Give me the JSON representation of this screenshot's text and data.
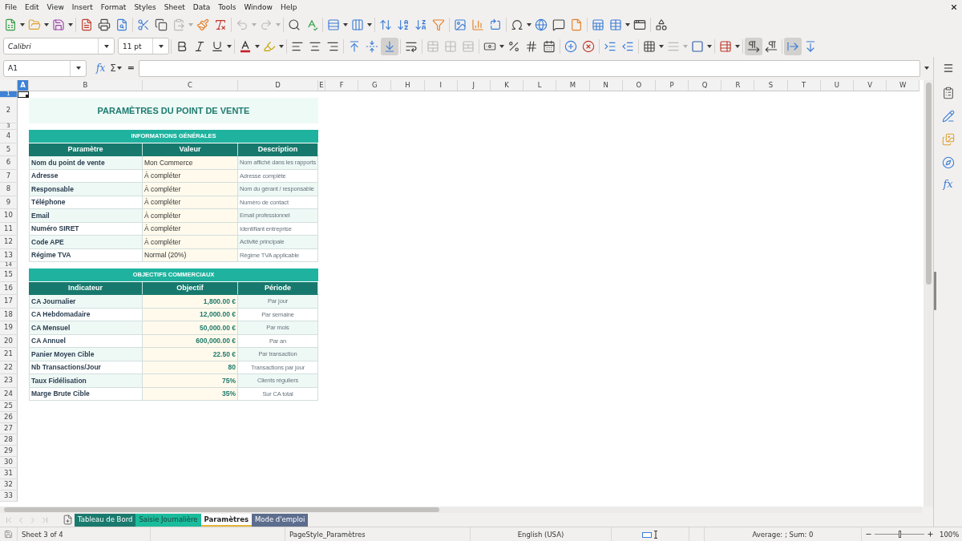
{
  "menu_bar": {
    "items": [
      "File",
      "Edit",
      "View",
      "Insert",
      "Format",
      "Styles",
      "Sheet",
      "Data",
      "Tools",
      "Window",
      "Help"
    ]
  },
  "standard_toolbar": [
    {
      "disabled": false
    },
    {
      "disabled": false
    },
    {
      "disabled": false
    },
    {
      "disabled": false
    },
    {
      "disabled": false
    },
    {
      "disabled": false
    },
    {
      "disabled": false
    },
    {
      "disabled": false
    },
    {
      "disabled": true
    },
    {
      "disabled": false
    },
    {
      "disabled": false
    },
    {
      "disabled": true
    },
    {
      "disabled": true
    },
    {
      "disabled": false
    },
    {
      "disabled": false
    },
    {
      "disabled": false
    },
    {
      "disabled": false
    },
    {
      "disabled": false
    },
    {
      "disabled": false
    },
    {
      "disabled": false
    },
    {
      "disabled": false
    },
    {
      "disabled": false
    },
    {
      "disabled": false
    },
    {
      "disabled": false
    },
    {
      "disabled": false
    },
    {
      "disabled": false
    },
    {
      "disabled": false
    },
    {
      "disabled": false
    },
    {
      "disabled": false
    },
    {
      "disabled": false
    },
    {
      "disabled": false
    },
    {
      "disabled": false
    }
  ],
  "formatting_toolbar": {
    "font_name": "Calibri",
    "font_size": "11 pt",
    "buttons": [
      {
        "pressed": false,
        "disabled": false
      },
      {
        "pressed": false,
        "disabled": false
      },
      {
        "pressed": false,
        "disabled": false
      },
      {
        "pressed": false,
        "disabled": false
      },
      {
        "pressed": false,
        "disabled": false
      },
      {
        "pressed": false,
        "disabled": false
      },
      {
        "pressed": false,
        "disabled": false
      },
      {
        "pressed": false,
        "disabled": false
      },
      {
        "pressed": false,
        "disabled": false
      },
      {
        "pressed": false,
        "disabled": false
      },
      {
        "pressed": true,
        "disabled": false
      },
      {
        "pressed": false,
        "disabled": false
      },
      {
        "pressed": false,
        "disabled": true
      },
      {
        "pressed": false,
        "disabled": true
      },
      {
        "pressed": false,
        "disabled": true
      },
      {
        "pressed": false,
        "disabled": false
      },
      {
        "pressed": false,
        "disabled": false
      },
      {
        "pressed": false,
        "disabled": false
      },
      {
        "pressed": false,
        "disabled": false
      },
      {
        "pressed": false,
        "disabled": false
      },
      {
        "pressed": false,
        "disabled": false
      },
      {
        "pressed": false,
        "disabled": false
      },
      {
        "pressed": false,
        "disabled": false
      },
      {
        "pressed": false,
        "disabled": false
      },
      {
        "pressed": false,
        "disabled": true
      },
      {
        "pressed": false,
        "disabled": false
      },
      {
        "pressed": false,
        "disabled": false
      },
      {
        "pressed": true,
        "disabled": false
      },
      {
        "pressed": false,
        "disabled": false
      },
      {
        "pressed": true,
        "disabled": false
      },
      {
        "pressed": false,
        "disabled": false
      }
    ]
  },
  "formula_bar": {
    "name_box": "A1",
    "function_wizard": "fx",
    "sum": "Σ",
    "formula": "="
  },
  "sidebar": {
    "functions": "fx"
  },
  "columns": [
    {
      "label": "A",
      "selected": true
    },
    {
      "label": "B",
      "selected": false
    },
    {
      "label": "C",
      "selected": false
    },
    {
      "label": "D",
      "selected": false
    },
    {
      "label": "E",
      "selected": false
    },
    {
      "label": "F",
      "selected": false
    },
    {
      "label": "G",
      "selected": false
    },
    {
      "label": "H",
      "selected": false
    },
    {
      "label": "I",
      "selected": false
    },
    {
      "label": "J",
      "selected": false
    },
    {
      "label": "K",
      "selected": false
    },
    {
      "label": "L",
      "selected": false
    },
    {
      "label": "M",
      "selected": false
    },
    {
      "label": "N",
      "selected": false
    },
    {
      "label": "O",
      "selected": false
    },
    {
      "label": "P",
      "selected": false
    },
    {
      "label": "Q",
      "selected": false
    },
    {
      "label": "R",
      "selected": false
    },
    {
      "label": "S",
      "selected": false
    },
    {
      "label": "T",
      "selected": false
    },
    {
      "label": "U",
      "selected": false
    },
    {
      "label": "V",
      "selected": false
    },
    {
      "label": "W",
      "selected": false
    }
  ],
  "rows": [
    {
      "number": "1",
      "kind": "spacer",
      "selected": true
    },
    {
      "number": "2",
      "kind": "title",
      "selected": false,
      "title": "PARAMÈTRES DU POINT DE VENTE"
    },
    {
      "number": "3",
      "kind": "spacer",
      "selected": false
    },
    {
      "number": "4",
      "kind": "section",
      "selected": false,
      "title": "INFORMATIONS GÉNÉRALES"
    },
    {
      "number": "5",
      "kind": "header",
      "selected": false,
      "cells": [
        "Paramètre",
        "Valeur",
        "Description"
      ]
    },
    {
      "number": "6",
      "kind": "parameter",
      "selected": false,
      "shaded": true,
      "cells": [
        "Nom du point de vente",
        "Mon Commerce",
        "Nom affiché dans les rapports"
      ]
    },
    {
      "number": "7",
      "kind": "parameter",
      "selected": false,
      "shaded": false,
      "cells": [
        "Adresse",
        "À compléter",
        "Adresse complète"
      ]
    },
    {
      "number": "8",
      "kind": "parameter",
      "selected": false,
      "shaded": true,
      "cells": [
        "Responsable",
        "À compléter",
        "Nom du gérant / responsable"
      ]
    },
    {
      "number": "9",
      "kind": "parameter",
      "selected": false,
      "shaded": false,
      "cells": [
        "Téléphone",
        "À compléter",
        "Numéro de contact"
      ]
    },
    {
      "number": "10",
      "kind": "parameter",
      "selected": false,
      "shaded": true,
      "cells": [
        "Email",
        "À compléter",
        "Email professionnel"
      ]
    },
    {
      "number": "11",
      "kind": "parameter",
      "selected": false,
      "shaded": false,
      "cells": [
        "Numéro SIRET",
        "À compléter",
        "Identifiant entreprise"
      ]
    },
    {
      "number": "12",
      "kind": "parameter",
      "selected": false,
      "shaded": true,
      "cells": [
        "Code APE",
        "À compléter",
        "Activité principale"
      ]
    },
    {
      "number": "13",
      "kind": "parameter",
      "selected": false,
      "shaded": false,
      "cells": [
        "Régime TVA",
        "Normal (20%)",
        "Régime TVA applicable"
      ]
    },
    {
      "number": "14",
      "kind": "spacer",
      "selected": false
    },
    {
      "number": "15",
      "kind": "section",
      "selected": false,
      "title": "OBJECTIFS COMMERCIAUX"
    },
    {
      "number": "16",
      "kind": "header",
      "selected": false,
      "cells": [
        "Indicateur",
        "Objectif",
        "Période"
      ]
    },
    {
      "number": "17",
      "kind": "target",
      "selected": false,
      "shaded": true,
      "cells": [
        "CA Journalier",
        "1,800.00 €",
        "Par jour"
      ]
    },
    {
      "number": "18",
      "kind": "target",
      "selected": false,
      "shaded": false,
      "cells": [
        "CA Hebdomadaire",
        "12,000.00 €",
        "Par semaine"
      ]
    },
    {
      "number": "19",
      "kind": "target",
      "selected": false,
      "shaded": true,
      "cells": [
        "CA Mensuel",
        "50,000.00 €",
        "Par mois"
      ]
    },
    {
      "number": "20",
      "kind": "target",
      "selected": false,
      "shaded": false,
      "cells": [
        "CA Annuel",
        "600,000.00 €",
        "Par an"
      ]
    },
    {
      "number": "21",
      "kind": "target",
      "selected": false,
      "shaded": true,
      "cells": [
        "Panier Moyen Cible",
        "22.50 €",
        "Par transaction"
      ]
    },
    {
      "number": "22",
      "kind": "target",
      "selected": false,
      "shaded": false,
      "cells": [
        "Nb Transactions/Jour",
        "80",
        "Transactions par jour"
      ]
    },
    {
      "number": "23",
      "kind": "target",
      "selected": false,
      "shaded": true,
      "cells": [
        "Taux Fidélisation",
        "75%",
        "Clients réguliers"
      ]
    },
    {
      "number": "24",
      "kind": "target",
      "selected": false,
      "shaded": false,
      "cells": [
        "Marge Brute Cible",
        "35%",
        "Sur CA total"
      ]
    },
    {
      "number": "25",
      "kind": "blank",
      "selected": false
    },
    {
      "number": "26",
      "kind": "blank",
      "selected": false
    },
    {
      "number": "27",
      "kind": "blank",
      "selected": false
    },
    {
      "number": "28",
      "kind": "blank",
      "selected": false
    },
    {
      "number": "29",
      "kind": "blank",
      "selected": false
    },
    {
      "number": "30",
      "kind": "blank",
      "selected": false
    },
    {
      "number": "31",
      "kind": "blank",
      "selected": false
    },
    {
      "number": "32",
      "kind": "blank",
      "selected": false
    },
    {
      "number": "33",
      "kind": "blank",
      "selected": false
    }
  ],
  "sheet_navigation": [
    {
      "disabled": true
    },
    {
      "disabled": true
    },
    {
      "disabled": true
    },
    {
      "disabled": true
    }
  ],
  "sheet_tabs": [
    {
      "label": "Tableau de Bord",
      "selected": false,
      "color": "#1a7a6e"
    },
    {
      "label": "Saisie Journalière",
      "selected": false,
      "color": "#1abc9c"
    },
    {
      "label": "Paramètres",
      "selected": true,
      "color": "#e5b73b"
    },
    {
      "label": "Mode d'emploi",
      "selected": false,
      "color": "#5d6d8e"
    }
  ],
  "status_bar": {
    "sheet": "Sheet 3 of 4",
    "page_style": "PageStyle_Paramètres",
    "language": "English (USA)",
    "selection_summary": "Average: ; Sum: 0",
    "zoom": {
      "level": 0.5,
      "reading": "100%"
    }
  }
}
